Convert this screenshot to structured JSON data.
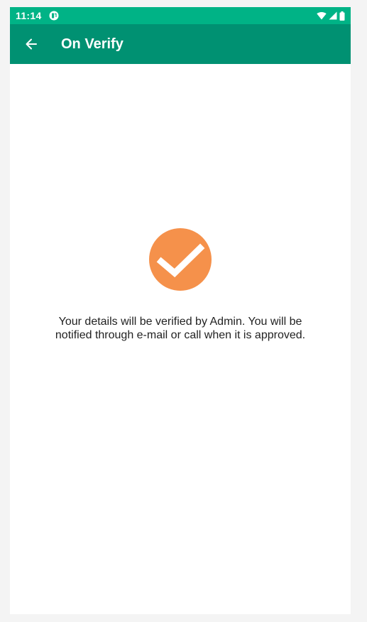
{
  "status_bar": {
    "time": "11:14",
    "app_icon": "fuel-app-icon",
    "wifi_icon": "wifi-icon",
    "signal_icon": "cell-signal-icon",
    "battery_icon": "battery-icon",
    "background_color": "#00b386"
  },
  "toolbar": {
    "title": "On Verify",
    "back_icon": "back-arrow-icon",
    "background_color": "#009172",
    "text_color": "#ffffff"
  },
  "main": {
    "status_icon": "check-circle-icon",
    "status_icon_color": "#f5914b",
    "message": "Your details will be verified by Admin. You will be notified through e-mail or call when it is approved."
  }
}
